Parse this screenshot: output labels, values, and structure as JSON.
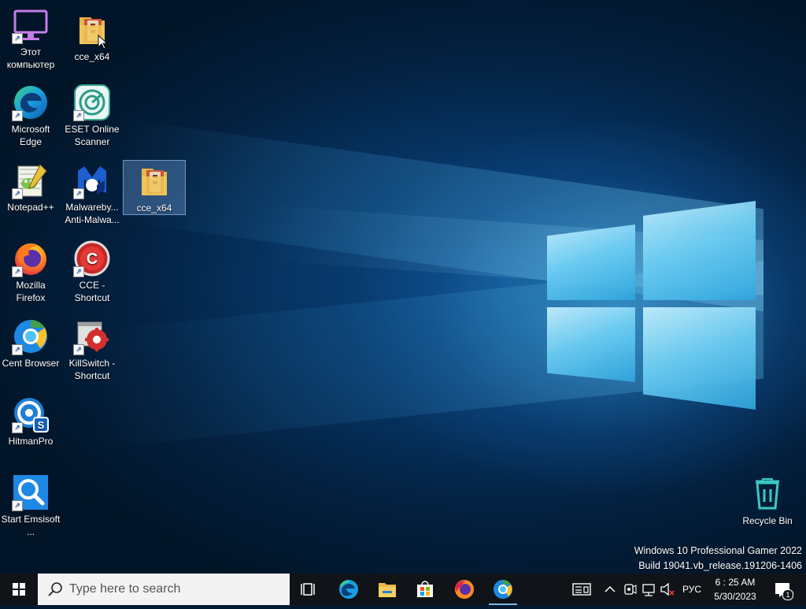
{
  "desktop": {
    "icons": [
      {
        "label": "Этот компьютер",
        "icon": "this-pc-icon"
      },
      {
        "label": "cce_x64",
        "icon": "folder-archive-icon"
      },
      {
        "label": "Microsoft Edge",
        "icon": "edge-icon"
      },
      {
        "label": "ESET Online Scanner",
        "icon": "eset-icon"
      },
      {
        "label": "Notepad++",
        "icon": "notepadpp-icon"
      },
      {
        "label": "Malwareby... Anti-Malwa...",
        "icon": "malwarebytes-icon"
      },
      {
        "label": "cce_x64",
        "icon": "folder-archive-icon"
      },
      {
        "label": "Mozilla Firefox",
        "icon": "firefox-icon"
      },
      {
        "label": "CCE - Shortcut",
        "icon": "cce-icon"
      },
      {
        "label": "Cent Browser",
        "icon": "cent-browser-icon"
      },
      {
        "label": "KillSwitch - Shortcut",
        "icon": "killswitch-icon"
      },
      {
        "label": "HitmanPro",
        "icon": "hitmanpro-icon"
      },
      {
        "label": "Start Emsisoft ...",
        "icon": "emsisoft-icon"
      },
      {
        "label": "Recycle Bin",
        "icon": "recycle-bin-icon"
      }
    ],
    "watermark": {
      "line1": "Windows 10 Professional Gamer 2022",
      "line2": "Build 19041.vb_release.191206-1406"
    }
  },
  "taskbar": {
    "search_placeholder": "Type here to search",
    "pinned": [
      "task-view-icon",
      "edge-icon",
      "file-explorer-icon",
      "microsoft-store-icon",
      "firefox-icon",
      "cent-browser-icon"
    ],
    "tray": {
      "language": "РУС",
      "time": "6 : 25 AM",
      "date": "5/30/2023",
      "notification_count": "1"
    }
  },
  "colors": {
    "taskbar_bg": "#101418",
    "accent": "#76b9ed",
    "desktop_bg": "#063463"
  }
}
